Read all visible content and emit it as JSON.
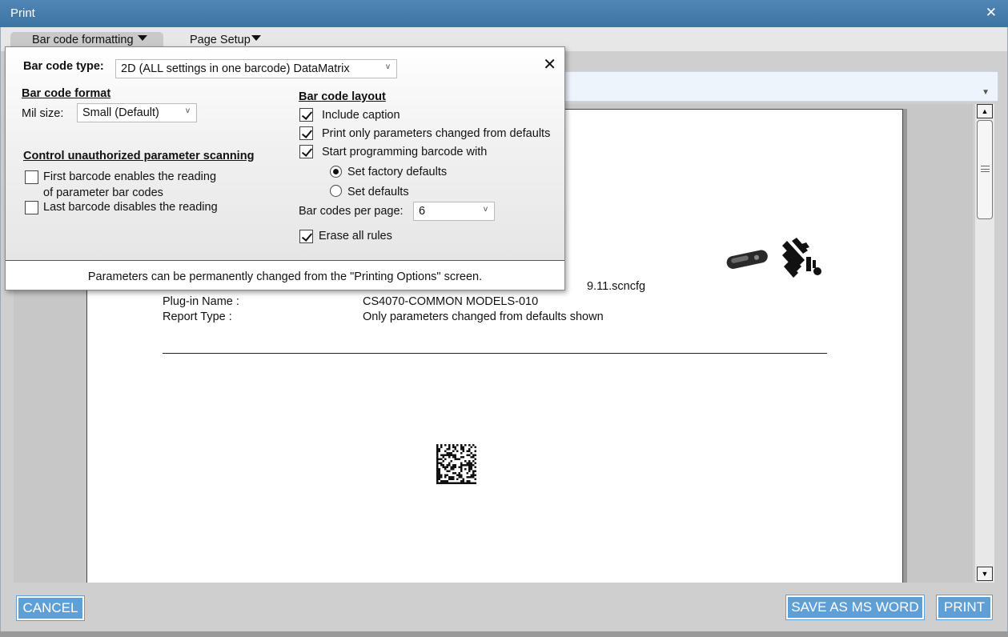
{
  "window": {
    "title": "Print"
  },
  "tabs": [
    {
      "label": "Bar code formatting"
    },
    {
      "label": "Page Setup"
    }
  ],
  "preview": {
    "filename_suffix": "9.11.scncfg",
    "plugin_name_label": "Plug-in Name :",
    "plugin_name_value": "CS4070-COMMON MODELS-010",
    "report_type_label": "Report Type :",
    "report_type_value": "Only parameters changed from defaults shown"
  },
  "popup": {
    "barcode_type_label": "Bar code type:",
    "barcode_type_value": "2D (ALL settings in one barcode) DataMatrix",
    "format_header": "Bar code format",
    "mil_size_label": "Mil size:",
    "mil_size_value": "Small (Default)",
    "control_header": "Control unauthorized parameter scanning",
    "first_barcode_line1": "First barcode enables the reading",
    "first_barcode_line2": "of parameter bar codes",
    "last_barcode": "Last barcode disables the reading",
    "layout_header": "Bar code layout",
    "include_caption": "Include caption",
    "print_only_changed": "Print only parameters changed from defaults",
    "start_programming": "Start programming barcode with",
    "set_factory_defaults": "Set factory defaults",
    "set_defaults": "Set defaults",
    "per_page_label": "Bar codes per page:",
    "per_page_value": "6",
    "erase_all_rules": "Erase all rules",
    "footer_note": "Parameters can be permanently changed from the \"Printing Options\" screen."
  },
  "buttons": {
    "cancel": "CANCEL",
    "save_word": "SAVE AS MS WORD",
    "print": "PRINT"
  },
  "colors": {
    "titlebar": "#4a80ad",
    "button": "#5d9fd6"
  }
}
